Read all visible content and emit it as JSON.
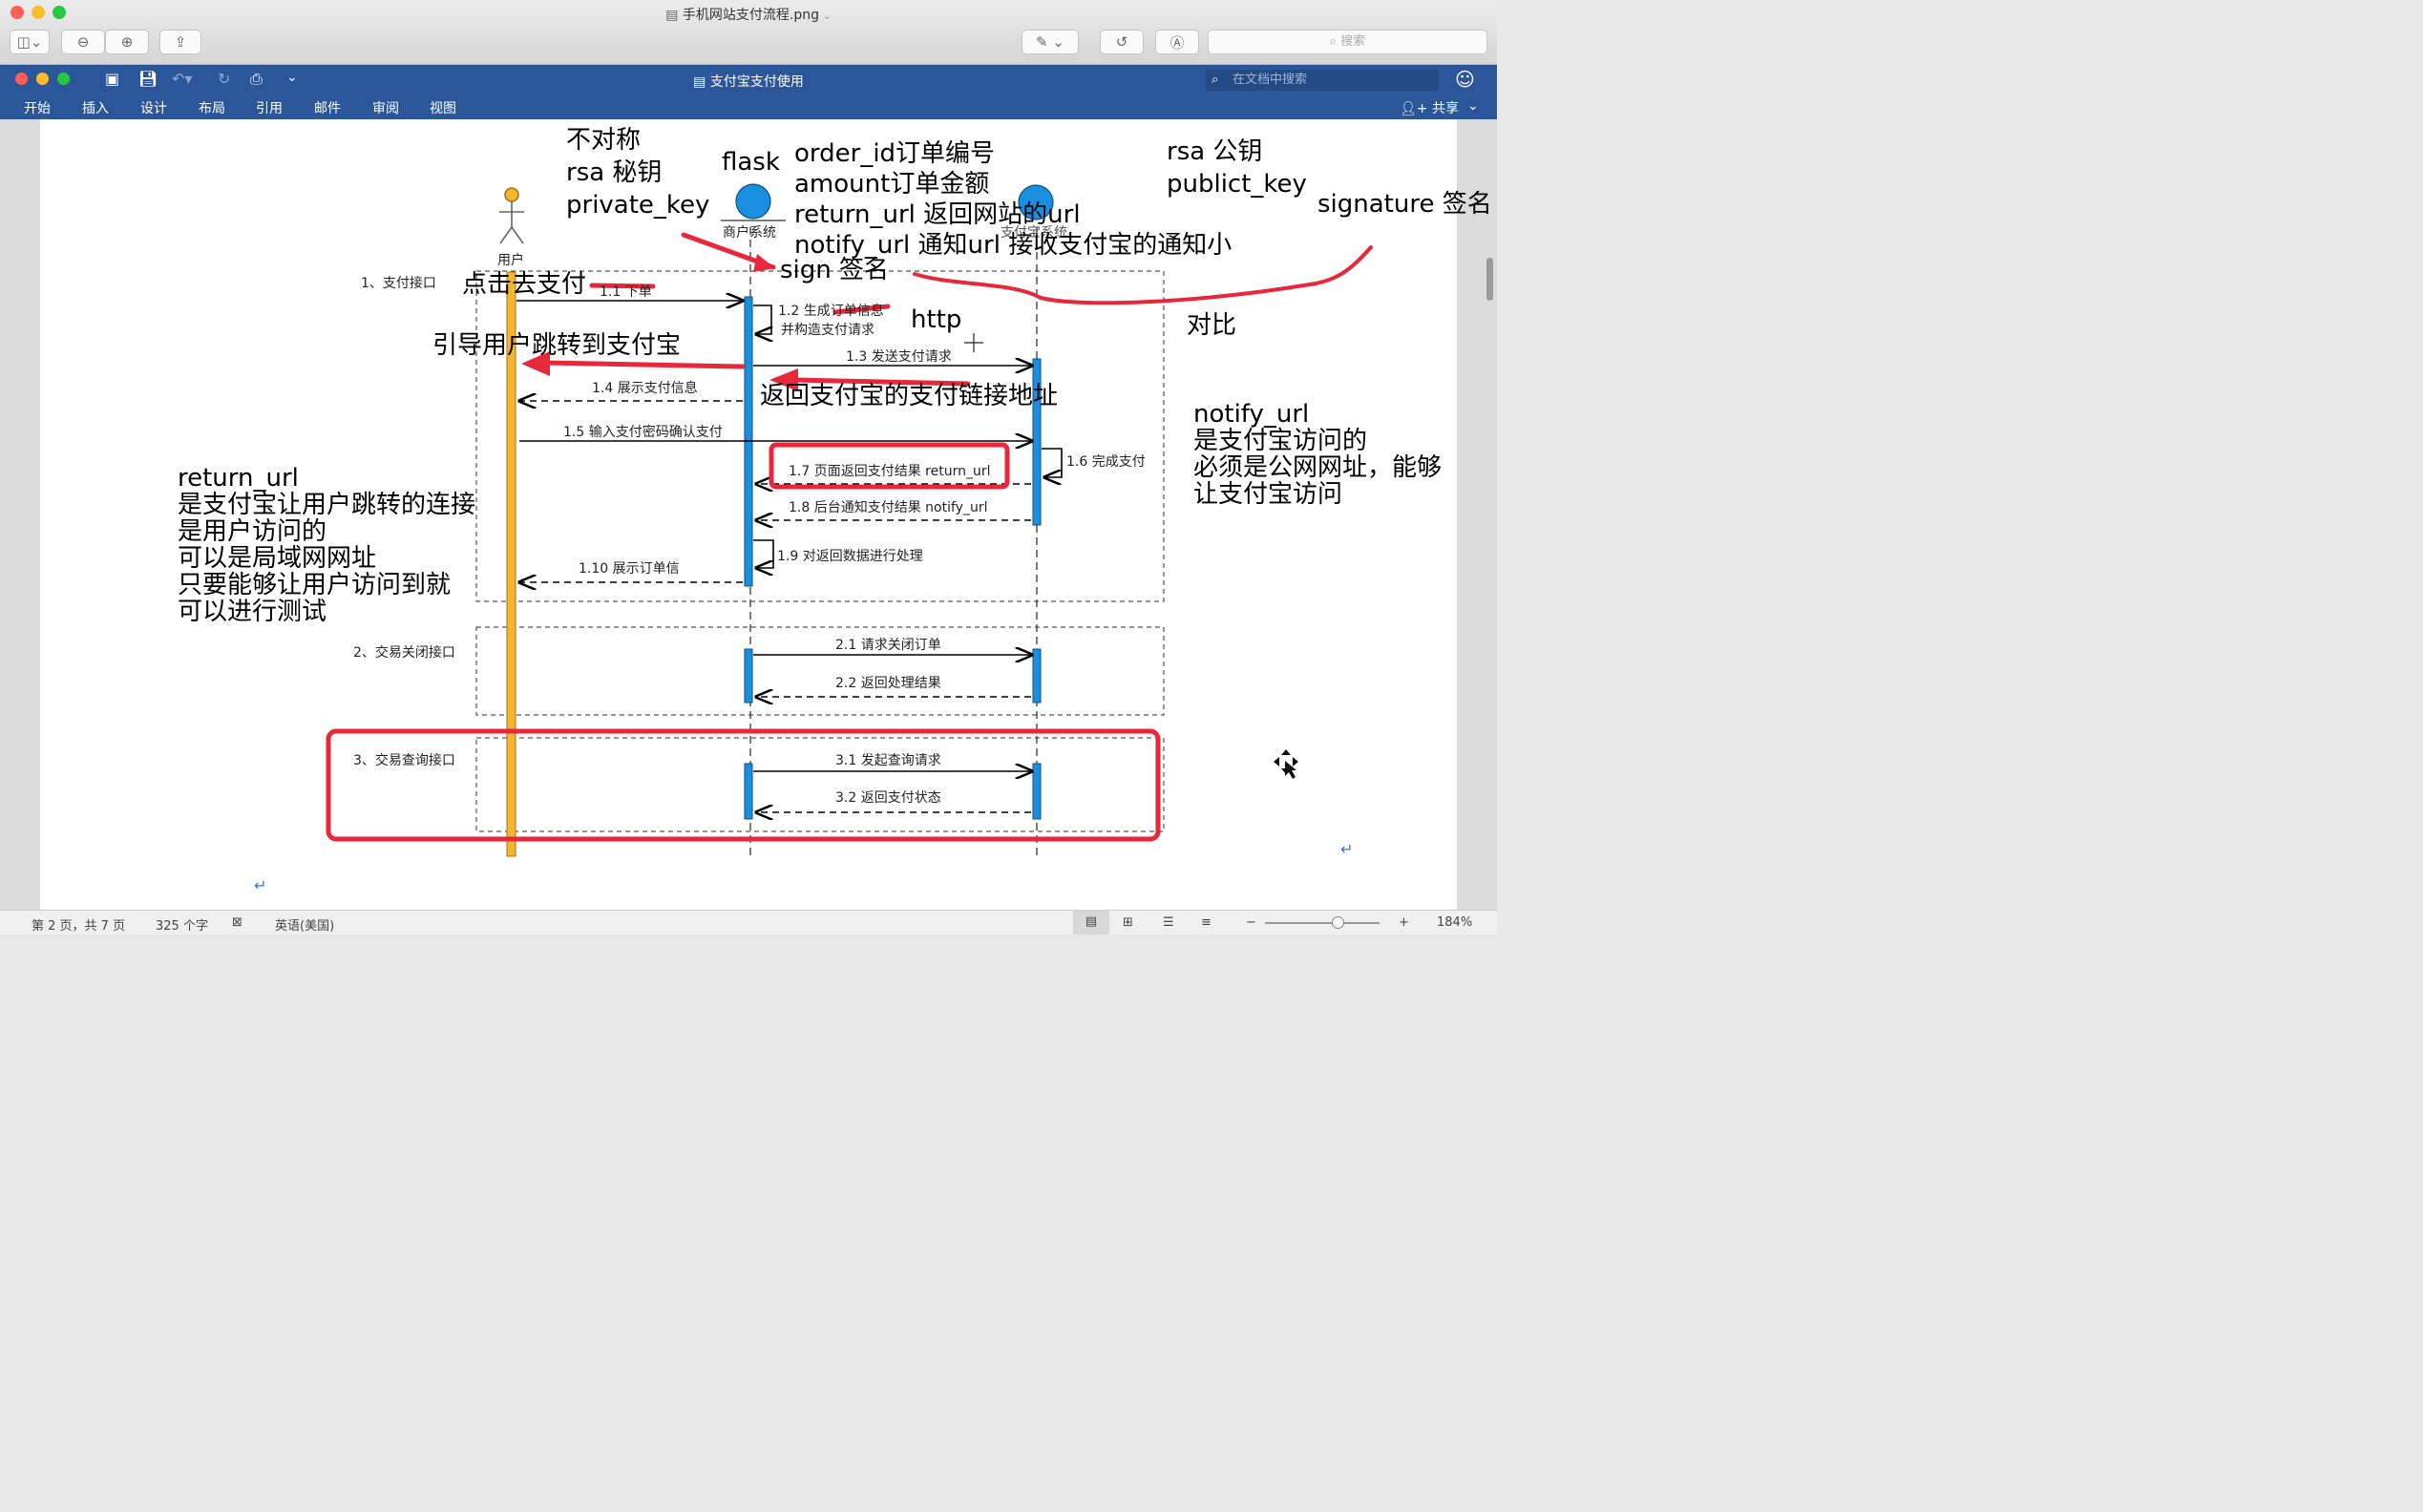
{
  "preview": {
    "title": "手机网站支付流程.png",
    "search_placeholder": "搜索"
  },
  "word": {
    "title": "支付宝支付使用",
    "search_placeholder": "在文档中搜索",
    "share_label": "共享",
    "ribbon_tabs": [
      "开始",
      "插入",
      "设计",
      "布局",
      "引用",
      "邮件",
      "审阅",
      "视图"
    ]
  },
  "diagram": {
    "actors": {
      "user": "用户",
      "merchant": "商户系统",
      "alipay": "支付宝系统"
    },
    "sections": [
      "1、支付接口",
      "2、交易关闭接口",
      "3、交易查询接口"
    ],
    "messages": {
      "m1_1": "1.1 下单",
      "m1_2a": "1.2 生成订单信息",
      "m1_2b": "并构造支付请求",
      "m1_3": "1.3 发送支付请求",
      "m1_4": "1.4 展示支付信息",
      "m1_5": "1.5 输入支付密码确认支付",
      "m1_6": "1.6 完成支付",
      "m1_7": "1.7 页面返回支付结果 return_url",
      "m1_8": "1.8 后台通知支付结果 notify_url",
      "m1_9": "1.9 对返回数据进行处理",
      "m1_10": "1.10  展示订单信",
      "m2_1": "2.1 请求关闭订单",
      "m2_2": "2.2 返回处理结果",
      "m3_1": "3.1 发起查询请求",
      "m3_2": "3.2 返回支付状态"
    }
  },
  "annotations": {
    "asym": [
      "不对称",
      "rsa 秘钥",
      "private_key"
    ],
    "flask": "flask",
    "order_fields": [
      "order_id订单编号",
      "amount订单金额",
      "return_url 返回网站的url",
      "notify_url 通知url 接收支付宝的通知小"
    ],
    "sign": "sign 签名",
    "rsa_pub": [
      "rsa 公钥",
      "publict_key"
    ],
    "signature": "signature 签名",
    "compare": "对比",
    "http": "http",
    "click_pay": "点击去支付",
    "guide_user": "引导用户跳转到支付宝",
    "return_link": "返回支付宝的支付链接地址",
    "notify_note": [
      "notify_url",
      "是支付宝访问的",
      "必须是公网网址，能够",
      "让支付宝访问"
    ],
    "return_note": [
      "return_url",
      "是支付宝让用户跳转的连接",
      "是用户访问的",
      "可以是局域网网址",
      "只要能够让用户访问到就",
      "可以进行测试"
    ]
  },
  "status": {
    "page": "第 2 页，共 7 页",
    "words": "325 个字",
    "language": "英语(美国)",
    "zoom": "184%"
  },
  "colors": {
    "word_blue": "#2b579a",
    "annotation_red": "#e8273b",
    "lifeline_blue": "#1a8fe0",
    "user_bar": "#f5b531"
  }
}
